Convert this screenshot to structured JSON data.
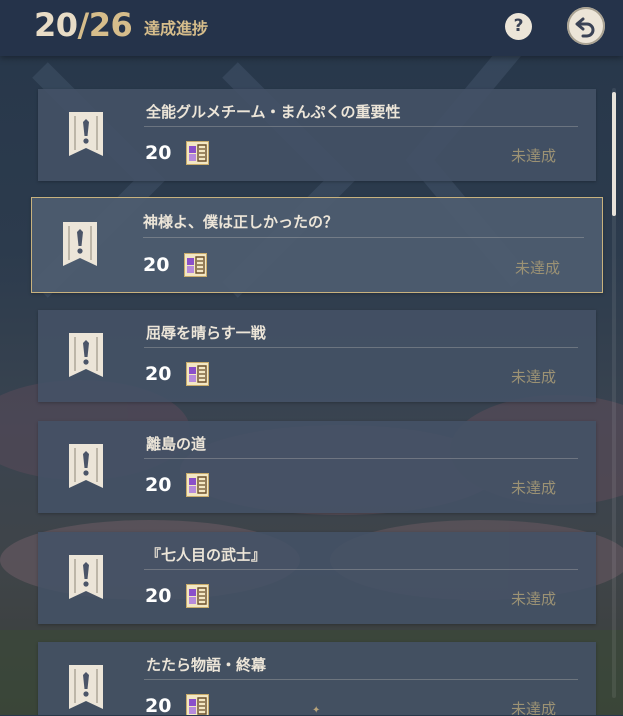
{
  "header": {
    "progress_current": "20",
    "progress_separator": "/",
    "progress_total": "26",
    "title": "達成進捗",
    "help_label": "?",
    "help_icon": "question-icon",
    "back_icon": "return-arrow-icon"
  },
  "achievements": [
    {
      "title": "全能グルメチーム・まんぷくの重要性",
      "reward": "20",
      "status": "未達成",
      "icon": "achievement-banner-icon",
      "reward_icon": "primogem-icon"
    },
    {
      "title": "神様よ、僕は正しかったの？",
      "reward": "20",
      "status": "未達成",
      "icon": "achievement-banner-icon",
      "reward_icon": "primogem-icon"
    },
    {
      "title": "屈辱を晴らす一戦",
      "reward": "20",
      "status": "未達成",
      "icon": "achievement-banner-icon",
      "reward_icon": "primogem-icon"
    },
    {
      "title": "離島の道",
      "reward": "20",
      "status": "未達成",
      "icon": "achievement-banner-icon",
      "reward_icon": "primogem-icon"
    },
    {
      "title": "『七人目の武士』",
      "reward": "20",
      "status": "未達成",
      "icon": "achievement-banner-icon",
      "reward_icon": "primogem-icon"
    },
    {
      "title": "たたら物語・終幕",
      "reward": "20",
      "status": "未達成",
      "icon": "achievement-banner-icon",
      "reward_icon": "primogem-icon"
    }
  ],
  "colors": {
    "header_bg": "#25334a",
    "card_bg": "#445266",
    "selected_border": "#c8b27e",
    "accent_gold": "#d6bd8b",
    "status_text": "#9c9274"
  }
}
